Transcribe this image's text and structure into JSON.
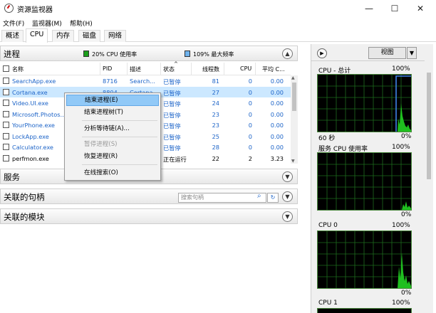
{
  "window": {
    "title": "资源监视器",
    "minimize": "—",
    "maximize": "☐",
    "close": "✕"
  },
  "menu": [
    "文件(F)",
    "监视器(M)",
    "帮助(H)"
  ],
  "tabs": [
    "概述",
    "CPU",
    "内存",
    "磁盘",
    "网络"
  ],
  "processes": {
    "title": "进程",
    "cpu_usage_label": "20% CPU 使用率",
    "max_freq_label": "109% 最大频率",
    "cpu_color": "#1a9e1a",
    "freq_color": "#6fb2ec",
    "columns": [
      "名称",
      "PID",
      "描述",
      "状态",
      "线程数",
      "CPU",
      "平均 C..."
    ],
    "rows": [
      {
        "name": "SearchApp.exe",
        "pid": "8716",
        "desc": "Search...",
        "status": "已暂停",
        "threads": "81",
        "cpu": "0",
        "avg": "0.00",
        "link": true
      },
      {
        "name": "Cortana.exe",
        "pid": "8804",
        "desc": "Cortana",
        "status": "已暂停",
        "threads": "27",
        "cpu": "0",
        "avg": "0.00",
        "link": true
      },
      {
        "name": "Video.UI.exe",
        "pid": "",
        "desc": "",
        "status": "已暂停",
        "threads": "24",
        "cpu": "0",
        "avg": "0.00",
        "link": true
      },
      {
        "name": "Microsoft.Photos...",
        "pid": "",
        "desc": "",
        "status": "已暂停",
        "threads": "23",
        "cpu": "0",
        "avg": "0.00",
        "link": true
      },
      {
        "name": "YourPhone.exe",
        "pid": "",
        "desc": "",
        "status": "已暂停",
        "threads": "23",
        "cpu": "0",
        "avg": "0.00",
        "link": true
      },
      {
        "name": "LockApp.exe",
        "pid": "",
        "desc": "",
        "status": "已暂停",
        "threads": "25",
        "cpu": "0",
        "avg": "0.00",
        "link": true
      },
      {
        "name": "Calculator.exe",
        "pid": "",
        "desc": "",
        "status": "已暂停",
        "threads": "28",
        "cpu": "0",
        "avg": "0.00",
        "link": true
      },
      {
        "name": "perfmon.exe",
        "pid": "",
        "desc": "",
        "status": "正在运行",
        "threads": "22",
        "cpu": "2",
        "avg": "3.23",
        "link": false
      }
    ]
  },
  "services": {
    "title": "服务"
  },
  "handles": {
    "title": "关联的句柄",
    "search_placeholder": "搜索句柄"
  },
  "modules": {
    "title": "关联的模块"
  },
  "context_menu": {
    "items": [
      {
        "label": "结束进程(E)",
        "state": "highlighted"
      },
      {
        "label": "结束进程树(T)",
        "state": "normal"
      },
      {
        "label": "分析等待链(A)...",
        "state": "normal"
      },
      {
        "label": "暂停进程(S)",
        "state": "disabled"
      },
      {
        "label": "恢复进程(R)",
        "state": "normal"
      },
      {
        "label": "在线搜索(O)",
        "state": "normal"
      }
    ]
  },
  "right_panel": {
    "view_label": "视图",
    "graphs": [
      {
        "title": "CPU - 总计",
        "top_pct": "100%",
        "left_bottom": "60 秒",
        "bottom_pct": "0%"
      },
      {
        "title": "服务 CPU 使用率",
        "top_pct": "100%",
        "left_bottom": "",
        "bottom_pct": "0%"
      },
      {
        "title": "CPU 0",
        "top_pct": "100%",
        "left_bottom": "",
        "bottom_pct": "0%"
      },
      {
        "title": "CPU 1",
        "top_pct": "100%",
        "left_bottom": "",
        "bottom_pct": ""
      }
    ]
  }
}
